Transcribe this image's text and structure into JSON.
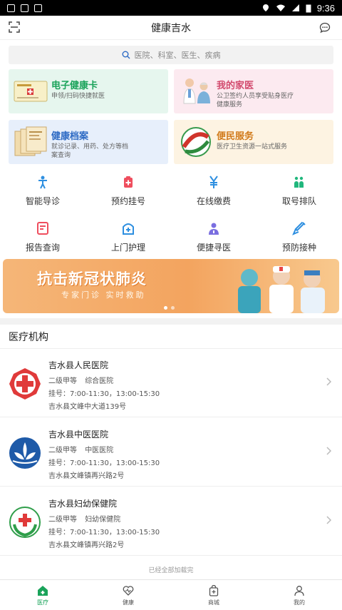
{
  "status_bar": {
    "time": "9:36"
  },
  "nav": {
    "title": "健康吉水"
  },
  "search": {
    "placeholder": "医院、科室、医生、疾病"
  },
  "cards": [
    {
      "title": "电子健康卡",
      "desc": "申领/扫码快捷就医"
    },
    {
      "title": "我的家医",
      "desc": "公卫签约人员享受贴身医疗健康服务"
    },
    {
      "title": "健康档案",
      "desc": "就诊记录、用药、处方等档案查询"
    },
    {
      "title": "便民服务",
      "desc": "医疗卫生资源一站式服务"
    }
  ],
  "menu": [
    {
      "label": "智能导诊",
      "icon": "guide-icon"
    },
    {
      "label": "预约挂号",
      "icon": "appointment-icon"
    },
    {
      "label": "在线缴费",
      "icon": "yen-icon"
    },
    {
      "label": "取号排队",
      "icon": "queue-icon"
    },
    {
      "label": "报告查询",
      "icon": "report-icon"
    },
    {
      "label": "上门护理",
      "icon": "nurse-icon"
    },
    {
      "label": "便捷寻医",
      "icon": "doctor-icon"
    },
    {
      "label": "预防接种",
      "icon": "vaccine-icon"
    }
  ],
  "banner": {
    "title": "抗击新冠状肺炎",
    "subtitle": "专家门诊  实时救助"
  },
  "section": {
    "title": "医疗机构"
  },
  "hospitals": [
    {
      "name": "吉水县人民医院",
      "grade": "二级甲等",
      "type": "综合医院",
      "hours": "挂号：7:00-11:30，13:00-15:30",
      "address": "吉水县文峰中大道139号"
    },
    {
      "name": "吉水县中医医院",
      "grade": "二级甲等",
      "type": "中医医院",
      "hours": "挂号：7:00-11:30，13:00-15:30",
      "address": "吉水县文峰镇再兴路2号"
    },
    {
      "name": "吉水县妇幼保健院",
      "grade": "二级甲等",
      "type": "妇幼保健院",
      "hours": "挂号：7:00-11:30，13:00-15:30",
      "address": "吉水县文峰镇再兴路2号"
    }
  ],
  "footer_note": "已经全部加载完",
  "tabs": [
    {
      "label": "医疗",
      "active": true
    },
    {
      "label": "健康",
      "active": false
    },
    {
      "label": "商城",
      "active": false
    },
    {
      "label": "我的",
      "active": false
    }
  ],
  "colors": {
    "accent": "#1aa35a",
    "banner": "#f3a45f"
  }
}
